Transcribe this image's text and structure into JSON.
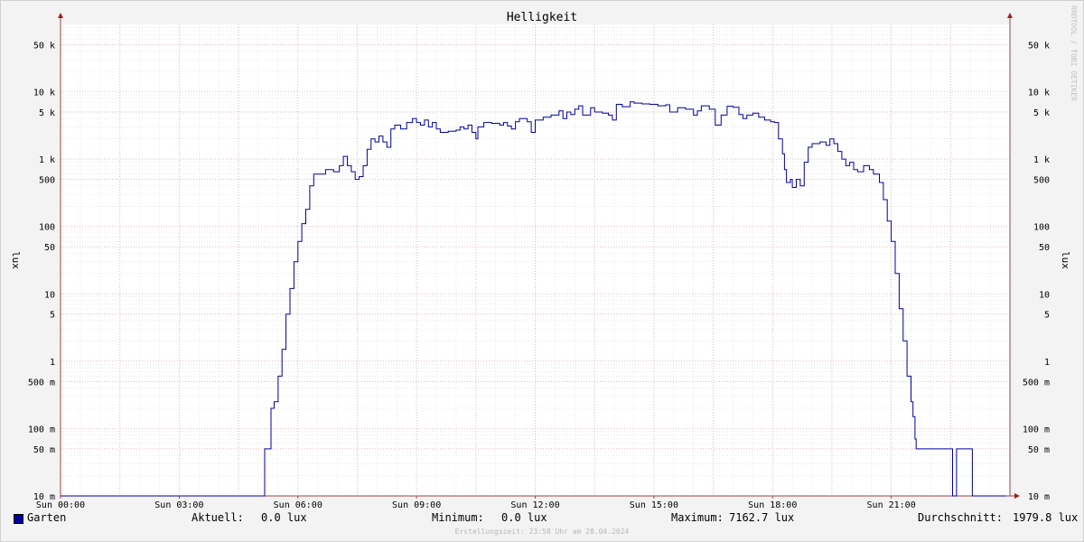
{
  "chart_data": {
    "type": "line",
    "title": "Helligkeit",
    "ylabel": "lux",
    "yscale": "log",
    "ylim": [
      0.01,
      100000
    ],
    "ytick_labels": [
      "10 m",
      "50 m",
      "100 m",
      "500 m",
      "1",
      "5",
      "10",
      "50",
      "100",
      "500",
      "1 k",
      "5 k",
      "10 k",
      "50 k"
    ],
    "ytick_values": [
      0.01,
      0.05,
      0.1,
      0.5,
      1,
      5,
      10,
      50,
      100,
      500,
      1000,
      5000,
      10000,
      50000
    ],
    "xlim_hours": [
      0,
      24
    ],
    "xtick_labels": [
      "Sun 00:00",
      "Sun 03:00",
      "Sun 06:00",
      "Sun 09:00",
      "Sun 12:00",
      "Sun 15:00",
      "Sun 18:00",
      "Sun 21:00"
    ],
    "xtick_hours": [
      0,
      3,
      6,
      9,
      12,
      15,
      18,
      21
    ],
    "grid": true,
    "series": [
      {
        "name": "Garten",
        "color": "#0000a0",
        "points": [
          [
            0.0,
            0.01
          ],
          [
            5.15,
            0.01
          ],
          [
            5.16,
            0.05
          ],
          [
            5.3,
            0.05
          ],
          [
            5.32,
            0.2
          ],
          [
            5.4,
            0.25
          ],
          [
            5.5,
            0.6
          ],
          [
            5.6,
            1.5
          ],
          [
            5.7,
            5
          ],
          [
            5.8,
            12
          ],
          [
            5.9,
            30
          ],
          [
            6.0,
            60
          ],
          [
            6.1,
            110
          ],
          [
            6.2,
            180
          ],
          [
            6.3,
            400
          ],
          [
            6.4,
            600
          ],
          [
            6.6,
            600
          ],
          [
            6.7,
            700
          ],
          [
            6.9,
            650
          ],
          [
            7.05,
            800
          ],
          [
            7.15,
            1100
          ],
          [
            7.25,
            800
          ],
          [
            7.35,
            650
          ],
          [
            7.45,
            500
          ],
          [
            7.55,
            550
          ],
          [
            7.65,
            800
          ],
          [
            7.75,
            1400
          ],
          [
            7.85,
            2000
          ],
          [
            7.95,
            1800
          ],
          [
            8.05,
            2200
          ],
          [
            8.15,
            1800
          ],
          [
            8.25,
            1500
          ],
          [
            8.35,
            2800
          ],
          [
            8.45,
            3200
          ],
          [
            8.6,
            2800
          ],
          [
            8.75,
            3500
          ],
          [
            8.9,
            4000
          ],
          [
            9.0,
            3500
          ],
          [
            9.1,
            3200
          ],
          [
            9.2,
            3800
          ],
          [
            9.3,
            3000
          ],
          [
            9.4,
            3500
          ],
          [
            9.5,
            2800
          ],
          [
            9.6,
            2500
          ],
          [
            9.8,
            2600
          ],
          [
            10.0,
            2700
          ],
          [
            10.1,
            3000
          ],
          [
            10.2,
            2800
          ],
          [
            10.3,
            3200
          ],
          [
            10.4,
            2500
          ],
          [
            10.5,
            2000
          ],
          [
            10.55,
            3000
          ],
          [
            10.7,
            3500
          ],
          [
            10.9,
            3400
          ],
          [
            11.1,
            3200
          ],
          [
            11.2,
            3500
          ],
          [
            11.3,
            3100
          ],
          [
            11.4,
            2800
          ],
          [
            11.5,
            3600
          ],
          [
            11.6,
            4000
          ],
          [
            11.8,
            3600
          ],
          [
            11.9,
            2500
          ],
          [
            12.0,
            3800
          ],
          [
            12.2,
            4200
          ],
          [
            12.4,
            4500
          ],
          [
            12.6,
            5200
          ],
          [
            12.7,
            4000
          ],
          [
            12.8,
            5000
          ],
          [
            12.9,
            4600
          ],
          [
            13.0,
            5500
          ],
          [
            13.1,
            6200
          ],
          [
            13.2,
            4500
          ],
          [
            13.4,
            5800
          ],
          [
            13.5,
            5000
          ],
          [
            13.7,
            4800
          ],
          [
            13.85,
            4500
          ],
          [
            13.95,
            3800
          ],
          [
            14.05,
            6500
          ],
          [
            14.2,
            6000
          ],
          [
            14.4,
            7100
          ],
          [
            14.5,
            6800
          ],
          [
            14.7,
            6600
          ],
          [
            14.9,
            6500
          ],
          [
            15.1,
            6200
          ],
          [
            15.3,
            6400
          ],
          [
            15.4,
            5000
          ],
          [
            15.6,
            5800
          ],
          [
            15.8,
            5500
          ],
          [
            16.0,
            4500
          ],
          [
            16.1,
            5200
          ],
          [
            16.2,
            6200
          ],
          [
            16.4,
            5500
          ],
          [
            16.55,
            3200
          ],
          [
            16.7,
            4500
          ],
          [
            16.85,
            6100
          ],
          [
            17.0,
            5900
          ],
          [
            17.15,
            4600
          ],
          [
            17.25,
            4000
          ],
          [
            17.35,
            4500
          ],
          [
            17.5,
            4800
          ],
          [
            17.65,
            4200
          ],
          [
            17.8,
            3800
          ],
          [
            17.95,
            3600
          ],
          [
            18.05,
            3500
          ],
          [
            18.15,
            2000
          ],
          [
            18.25,
            1200
          ],
          [
            18.3,
            700
          ],
          [
            18.35,
            450
          ],
          [
            18.45,
            500
          ],
          [
            18.5,
            380
          ],
          [
            18.6,
            500
          ],
          [
            18.7,
            400
          ],
          [
            18.8,
            900
          ],
          [
            18.9,
            1500
          ],
          [
            19.0,
            1700
          ],
          [
            19.2,
            1800
          ],
          [
            19.35,
            1600
          ],
          [
            19.45,
            2000
          ],
          [
            19.55,
            1700
          ],
          [
            19.65,
            1300
          ],
          [
            19.75,
            1000
          ],
          [
            19.85,
            800
          ],
          [
            19.95,
            900
          ],
          [
            20.05,
            700
          ],
          [
            20.15,
            650
          ],
          [
            20.3,
            800
          ],
          [
            20.45,
            700
          ],
          [
            20.55,
            600
          ],
          [
            20.7,
            450
          ],
          [
            20.8,
            250
          ],
          [
            20.9,
            120
          ],
          [
            21.0,
            60
          ],
          [
            21.1,
            20
          ],
          [
            21.2,
            6
          ],
          [
            21.3,
            2
          ],
          [
            21.4,
            0.6
          ],
          [
            21.5,
            0.25
          ],
          [
            21.55,
            0.15
          ],
          [
            21.6,
            0.07
          ],
          [
            21.63,
            0.05
          ],
          [
            22.5,
            0.05
          ],
          [
            22.55,
            0.01
          ],
          [
            22.6,
            0.01
          ],
          [
            22.65,
            0.05
          ],
          [
            23.0,
            0.05
          ],
          [
            23.05,
            0.01
          ],
          [
            23.9,
            0.01
          ]
        ]
      }
    ]
  },
  "legend": {
    "series_name": "Garten",
    "current_label": "Aktuell:",
    "current_value": "0.0 lux",
    "min_label": "Minimum:",
    "min_value": "0.0 lux",
    "max_label": "Maximum:",
    "max_value": "7162.7 lux",
    "avg_label": "Durchschnitt:",
    "avg_value": "1979.8 lux"
  },
  "footer": "Erstellungszeit: 23:58 Uhr am 28.04.2024",
  "watermark": "RRDTOOL / TOBI OETIKER"
}
